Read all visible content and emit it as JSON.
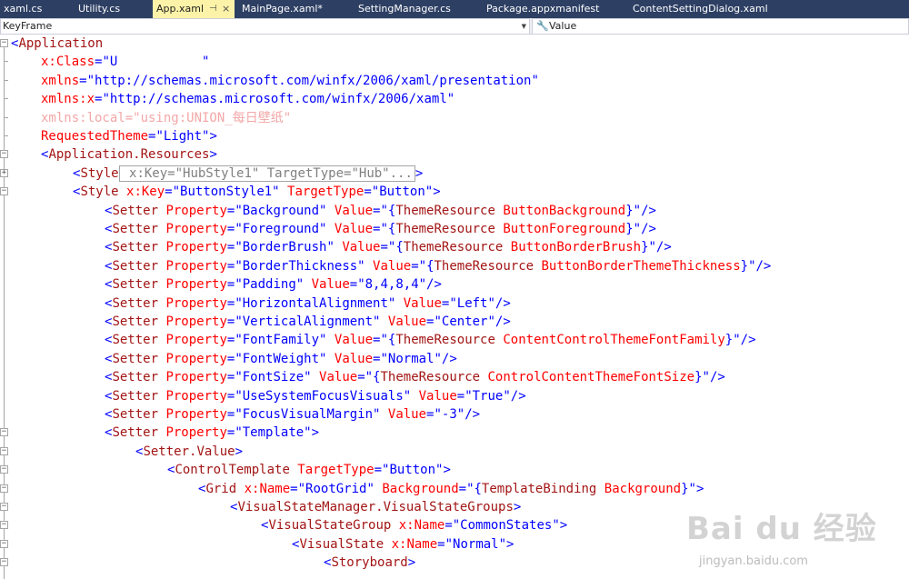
{
  "tabs": [
    {
      "label": "xaml.cs",
      "active": false
    },
    {
      "label": "Utility.cs",
      "active": false
    },
    {
      "label": "App.xaml",
      "active": true
    },
    {
      "label": "MainPage.xaml*",
      "active": false
    },
    {
      "label": "SettingManager.cs",
      "active": false
    },
    {
      "label": "Package.appxmanifest",
      "active": false
    },
    {
      "label": "ContentSettingDialog.xaml",
      "active": false
    }
  ],
  "navbar": {
    "left_value": "KeyFrame",
    "right_value": "Value"
  },
  "code_lines": [
    {
      "fold": "minus",
      "tokens": [
        [
          "p",
          "<"
        ],
        [
          "e",
          "Application"
        ]
      ]
    },
    {
      "fold": "",
      "tokens": [
        [
          "a",
          "x:Class"
        ],
        [
          "p",
          "="
        ],
        [
          "v",
          "\"U"
        ],
        [
          "v",
          "           "
        ],
        [
          "v",
          "\""
        ]
      ]
    },
    {
      "fold": "",
      "tokens": [
        [
          "a",
          "xmlns"
        ],
        [
          "p",
          "="
        ],
        [
          "v",
          "\"http://schemas.microsoft.com/winfx/2006/xaml/presentation\""
        ]
      ]
    },
    {
      "fold": "",
      "tokens": [
        [
          "a",
          "xmlns:x"
        ],
        [
          "p",
          "="
        ],
        [
          "v",
          "\"http://schemas.microsoft.com/winfx/2006/xaml\""
        ]
      ]
    },
    {
      "fold": "",
      "tokens": [
        [
          "f",
          "xmlns:local=\"using:UNION_每日壁纸\""
        ]
      ]
    },
    {
      "fold": "",
      "tokens": [
        [
          "a",
          "RequestedTheme"
        ],
        [
          "p",
          "="
        ],
        [
          "v",
          "\"Light\""
        ],
        [
          "p",
          ">"
        ]
      ]
    },
    {
      "fold": "minus",
      "tokens": [
        [
          "p",
          "<"
        ],
        [
          "e",
          "Application.Resources"
        ],
        [
          "p",
          ">"
        ]
      ]
    },
    {
      "fold": "plus",
      "tokens": [
        [
          "p",
          "<"
        ],
        [
          "e",
          "Style"
        ],
        [
          "c",
          " x:Key=\"HubStyle1\" TargetType=\"Hub\"..."
        ],
        [
          "p",
          ">"
        ]
      ]
    },
    {
      "fold": "minus",
      "tokens": [
        [
          "p",
          "<"
        ],
        [
          "e",
          "Style"
        ],
        [
          "a",
          " x:Key"
        ],
        [
          "p",
          "="
        ],
        [
          "v",
          "\"ButtonStyle1\""
        ],
        [
          "a",
          " TargetType"
        ],
        [
          "p",
          "="
        ],
        [
          "v",
          "\"Button\""
        ],
        [
          "p",
          ">"
        ]
      ]
    },
    {
      "fold": "",
      "tokens": [
        [
          "p",
          "<"
        ],
        [
          "e",
          "Setter"
        ],
        [
          "a",
          " Property"
        ],
        [
          "p",
          "="
        ],
        [
          "v",
          "\"Background\""
        ],
        [
          "a",
          " Value"
        ],
        [
          "p",
          "="
        ],
        [
          "v",
          "\"{"
        ],
        [
          "e",
          "ThemeResource"
        ],
        [
          "a",
          " ButtonBackground"
        ],
        [
          "v",
          "}\""
        ],
        [
          "p",
          "/>"
        ]
      ]
    },
    {
      "fold": "",
      "tokens": [
        [
          "p",
          "<"
        ],
        [
          "e",
          "Setter"
        ],
        [
          "a",
          " Property"
        ],
        [
          "p",
          "="
        ],
        [
          "v",
          "\"Foreground\""
        ],
        [
          "a",
          " Value"
        ],
        [
          "p",
          "="
        ],
        [
          "v",
          "\"{"
        ],
        [
          "e",
          "ThemeResource"
        ],
        [
          "a",
          " ButtonForeground"
        ],
        [
          "v",
          "}\""
        ],
        [
          "p",
          "/>"
        ]
      ]
    },
    {
      "fold": "",
      "tokens": [
        [
          "p",
          "<"
        ],
        [
          "e",
          "Setter"
        ],
        [
          "a",
          " Property"
        ],
        [
          "p",
          "="
        ],
        [
          "v",
          "\"BorderBrush\""
        ],
        [
          "a",
          " Value"
        ],
        [
          "p",
          "="
        ],
        [
          "v",
          "\"{"
        ],
        [
          "e",
          "ThemeResource"
        ],
        [
          "a",
          " ButtonBorderBrush"
        ],
        [
          "v",
          "}\""
        ],
        [
          "p",
          "/>"
        ]
      ]
    },
    {
      "fold": "",
      "tokens": [
        [
          "p",
          "<"
        ],
        [
          "e",
          "Setter"
        ],
        [
          "a",
          " Property"
        ],
        [
          "p",
          "="
        ],
        [
          "v",
          "\"BorderThickness\""
        ],
        [
          "a",
          " Value"
        ],
        [
          "p",
          "="
        ],
        [
          "v",
          "\"{"
        ],
        [
          "e",
          "ThemeResource"
        ],
        [
          "a",
          " ButtonBorderThemeThickness"
        ],
        [
          "v",
          "}\""
        ],
        [
          "p",
          "/>"
        ]
      ]
    },
    {
      "fold": "",
      "tokens": [
        [
          "p",
          "<"
        ],
        [
          "e",
          "Setter"
        ],
        [
          "a",
          " Property"
        ],
        [
          "p",
          "="
        ],
        [
          "v",
          "\"Padding\""
        ],
        [
          "a",
          " Value"
        ],
        [
          "p",
          "="
        ],
        [
          "v",
          "\"8,4,8,4\""
        ],
        [
          "p",
          "/>"
        ]
      ]
    },
    {
      "fold": "",
      "tokens": [
        [
          "p",
          "<"
        ],
        [
          "e",
          "Setter"
        ],
        [
          "a",
          " Property"
        ],
        [
          "p",
          "="
        ],
        [
          "v",
          "\"HorizontalAlignment\""
        ],
        [
          "a",
          " Value"
        ],
        [
          "p",
          "="
        ],
        [
          "v",
          "\"Left\""
        ],
        [
          "p",
          "/>"
        ]
      ]
    },
    {
      "fold": "",
      "tokens": [
        [
          "p",
          "<"
        ],
        [
          "e",
          "Setter"
        ],
        [
          "a",
          " Property"
        ],
        [
          "p",
          "="
        ],
        [
          "v",
          "\"VerticalAlignment\""
        ],
        [
          "a",
          " Value"
        ],
        [
          "p",
          "="
        ],
        [
          "v",
          "\"Center\""
        ],
        [
          "p",
          "/>"
        ]
      ]
    },
    {
      "fold": "",
      "tokens": [
        [
          "p",
          "<"
        ],
        [
          "e",
          "Setter"
        ],
        [
          "a",
          " Property"
        ],
        [
          "p",
          "="
        ],
        [
          "v",
          "\"FontFamily\""
        ],
        [
          "a",
          " Value"
        ],
        [
          "p",
          "="
        ],
        [
          "v",
          "\"{"
        ],
        [
          "e",
          "ThemeResource"
        ],
        [
          "a",
          " ContentControlThemeFontFamily"
        ],
        [
          "v",
          "}\""
        ],
        [
          "p",
          "/>"
        ]
      ]
    },
    {
      "fold": "",
      "tokens": [
        [
          "p",
          "<"
        ],
        [
          "e",
          "Setter"
        ],
        [
          "a",
          " Property"
        ],
        [
          "p",
          "="
        ],
        [
          "v",
          "\"FontWeight\""
        ],
        [
          "a",
          " Value"
        ],
        [
          "p",
          "="
        ],
        [
          "v",
          "\"Normal\""
        ],
        [
          "p",
          "/>"
        ]
      ]
    },
    {
      "fold": "",
      "tokens": [
        [
          "p",
          "<"
        ],
        [
          "e",
          "Setter"
        ],
        [
          "a",
          " Property"
        ],
        [
          "p",
          "="
        ],
        [
          "v",
          "\"FontSize\""
        ],
        [
          "a",
          " Value"
        ],
        [
          "p",
          "="
        ],
        [
          "v",
          "\"{"
        ],
        [
          "e",
          "ThemeResource"
        ],
        [
          "a",
          " ControlContentThemeFontSize"
        ],
        [
          "v",
          "}\""
        ],
        [
          "p",
          "/>"
        ]
      ]
    },
    {
      "fold": "",
      "tokens": [
        [
          "p",
          "<"
        ],
        [
          "e",
          "Setter"
        ],
        [
          "a",
          " Property"
        ],
        [
          "p",
          "="
        ],
        [
          "v",
          "\"UseSystemFocusVisuals\""
        ],
        [
          "a",
          " Value"
        ],
        [
          "p",
          "="
        ],
        [
          "v",
          "\"True\""
        ],
        [
          "p",
          "/>"
        ]
      ]
    },
    {
      "fold": "",
      "tokens": [
        [
          "p",
          "<"
        ],
        [
          "e",
          "Setter"
        ],
        [
          "a",
          " Property"
        ],
        [
          "p",
          "="
        ],
        [
          "v",
          "\"FocusVisualMargin\""
        ],
        [
          "a",
          " Value"
        ],
        [
          "p",
          "="
        ],
        [
          "v",
          "\"-3\""
        ],
        [
          "p",
          "/>"
        ]
      ]
    },
    {
      "fold": "minus",
      "tokens": [
        [
          "p",
          "<"
        ],
        [
          "e",
          "Setter"
        ],
        [
          "a",
          " Property"
        ],
        [
          "p",
          "="
        ],
        [
          "v",
          "\"Template\""
        ],
        [
          "p",
          ">"
        ]
      ]
    },
    {
      "fold": "minus",
      "tokens": [
        [
          "p",
          "<"
        ],
        [
          "e",
          "Setter.Value"
        ],
        [
          "p",
          ">"
        ]
      ]
    },
    {
      "fold": "minus",
      "tokens": [
        [
          "p",
          "<"
        ],
        [
          "e",
          "ControlTemplate"
        ],
        [
          "a",
          " TargetType"
        ],
        [
          "p",
          "="
        ],
        [
          "v",
          "\"Button\""
        ],
        [
          "p",
          ">"
        ]
      ]
    },
    {
      "fold": "minus",
      "tokens": [
        [
          "p",
          "<"
        ],
        [
          "e",
          "Grid"
        ],
        [
          "a",
          " x:Name"
        ],
        [
          "p",
          "="
        ],
        [
          "v",
          "\"RootGrid\""
        ],
        [
          "a",
          " Background"
        ],
        [
          "p",
          "="
        ],
        [
          "v",
          "\"{"
        ],
        [
          "e",
          "TemplateBinding"
        ],
        [
          "a",
          " Background"
        ],
        [
          "v",
          "}\""
        ],
        [
          "p",
          ">"
        ]
      ]
    },
    {
      "fold": "minus",
      "tokens": [
        [
          "p",
          "<"
        ],
        [
          "e",
          "VisualStateManager.VisualStateGroups"
        ],
        [
          "p",
          ">"
        ]
      ]
    },
    {
      "fold": "minus",
      "tokens": [
        [
          "p",
          "<"
        ],
        [
          "e",
          "VisualStateGroup"
        ],
        [
          "a",
          " x:Name"
        ],
        [
          "p",
          "="
        ],
        [
          "v",
          "\"CommonStates\""
        ],
        [
          "p",
          ">"
        ]
      ]
    },
    {
      "fold": "minus",
      "tokens": [
        [
          "p",
          "<"
        ],
        [
          "e",
          "VisualState"
        ],
        [
          "a",
          " x:Name"
        ],
        [
          "p",
          "="
        ],
        [
          "v",
          "\"Normal\""
        ],
        [
          "p",
          ">"
        ]
      ]
    },
    {
      "fold": "minus",
      "tokens": [
        [
          "p",
          "<"
        ],
        [
          "e",
          "Storyboard"
        ],
        [
          "p",
          ">"
        ]
      ]
    }
  ],
  "watermark": {
    "logo_text": "Bai du 经验",
    "url_text": "jingyan.baidu.com"
  },
  "colors": {
    "tab_bar": "#2d3f63",
    "active_tab": "#fdf3a8",
    "element": "#a31515",
    "attribute": "#ff0000",
    "value": "#0000ff"
  }
}
